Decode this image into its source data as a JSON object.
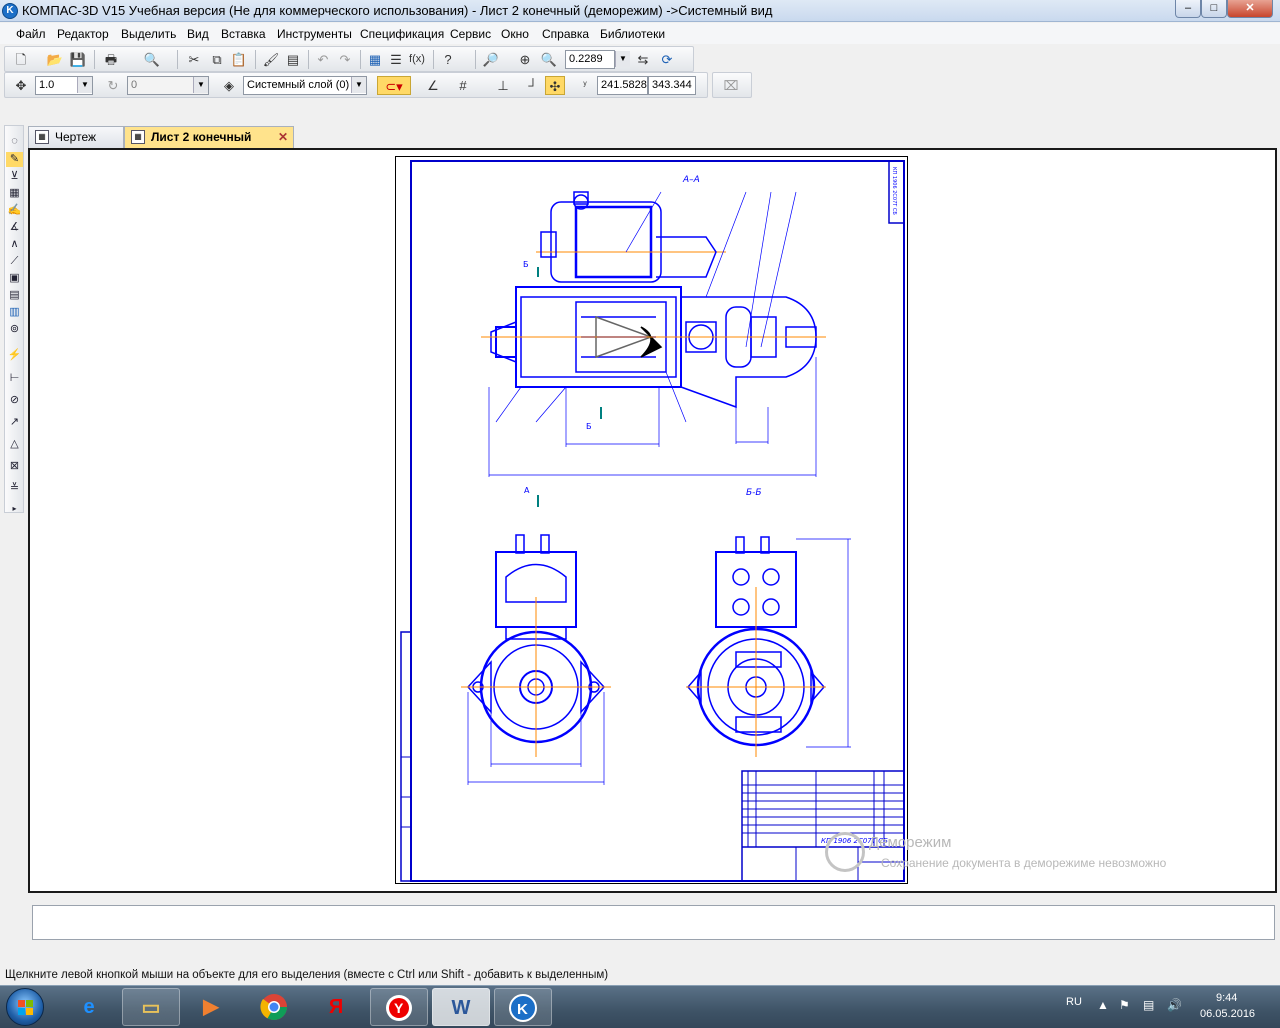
{
  "window": {
    "title": "КОМПАС-3D V15 Учебная версия (Не для коммерческого использования) - Лист 2 конечный (деморежим) ->Системный вид",
    "app_icon_letter": "K",
    "minimize": "–",
    "maximize": "□",
    "close": "✕"
  },
  "menu": {
    "items": [
      "Файл",
      "Редактор",
      "Выделить",
      "Вид",
      "Вставка",
      "Инструменты",
      "Спецификация",
      "Сервис",
      "Окно",
      "Справка",
      "Библиотеки"
    ]
  },
  "toolbar1": {
    "zoom_value": "0.2289"
  },
  "toolbar2": {
    "step_value": "1.0",
    "angle_value": "0",
    "layer_value": "Системный слой (0)",
    "coord_x": "241.5828",
    "coord_y": "343.344"
  },
  "tabs": [
    {
      "label": "Чертеж",
      "active": false
    },
    {
      "label": "Лист 2 конечный",
      "active": true,
      "close": "✕"
    }
  ],
  "drawing": {
    "section_aa": "А–А",
    "section_bb": "Б-Б",
    "view_a": "А",
    "cut_b": "Б",
    "title_block_code": "КП 1906 2С07Т СБ",
    "colors": {
      "line": "#0000ff",
      "frame": "#0000cc",
      "accent": "#008080"
    }
  },
  "demo": {
    "title": "Деморежим",
    "subtitle": "Сохранение документа в деморежиме невозможно"
  },
  "status": {
    "text": "Щелкните левой кнопкой мыши на объекте для его выделения (вместе с Ctrl или Shift - добавить к выделенным)"
  },
  "taskbar": {
    "apps": [
      "ie-icon",
      "explorer-icon",
      "media-player-icon",
      "chrome-icon",
      "yandex-icon",
      "yandex-browser-icon",
      "word-icon",
      "kompas-icon"
    ],
    "yandex_label": "Я",
    "word_label": "W",
    "language": "RU",
    "time": "9:44",
    "date": "06.05.2016"
  }
}
